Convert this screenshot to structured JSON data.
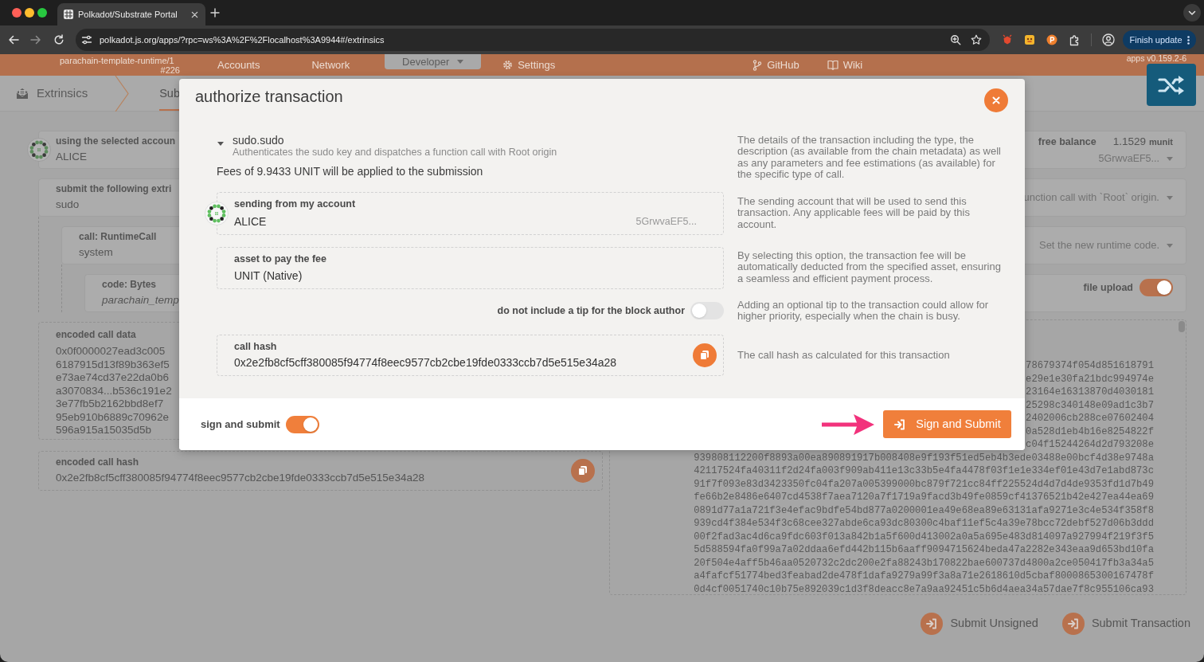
{
  "browser": {
    "tab_title": "Polkadot/Substrate Portal",
    "url": "polkadot.js.org/apps/?rpc=ws%3A%2F%2Flocalhost%3A9944#/extrinsics",
    "update_button": "Finish update"
  },
  "nav": {
    "chain": "parachain-template-runtime/1",
    "block": "#226",
    "menu": [
      {
        "label": "Accounts",
        "selected": false,
        "kind": "menu"
      },
      {
        "label": "Network",
        "selected": false,
        "kind": "menu"
      },
      {
        "label": "Developer",
        "selected": true,
        "kind": "menu"
      },
      {
        "label": "Settings",
        "selected": false,
        "kind": "settings"
      }
    ],
    "links": [
      {
        "label": "GitHub",
        "kind": "repo"
      },
      {
        "label": "Wiki",
        "kind": "docs"
      }
    ],
    "version": "apps v0.159.2-6"
  },
  "subnav": {
    "title": "Extrinsics",
    "tabs": [
      {
        "label": "Sub",
        "selected": true
      }
    ]
  },
  "page": {
    "account": {
      "label": "using the selected accoun",
      "value": "ALICE",
      "balance_label": "free balance",
      "balance": "1.1529",
      "balance_unit": "munit",
      "address": "5GrwvaEF5..."
    },
    "params": [
      {
        "label": "submit the following extri",
        "value": "sudo",
        "summary": "unction call with `Root` origin.",
        "kind": "select",
        "children": [
          {
            "label": "call: RuntimeCall",
            "value": "system",
            "summary": "Set the new runtime code.",
            "kind": "select",
            "children": [
              {
                "label": "code: Bytes",
                "value": "parachain_temp",
                "toggle_label": "file upload",
                "on": true,
                "kind": "file"
              }
            ]
          }
        ]
      }
    ],
    "encoded_call_data": {
      "label": "encoded call data",
      "lines": [
        "0x0f0000027ead3c005",
        "6187915d13f89b363ef5",
        "e73ae74cd37e22da0b6",
        "a3070834...b536c191e2",
        "3e77fb5b2162bbd8ef7",
        "95eb910b6889c70962e",
        "596a915a15035d5b"
      ]
    },
    "hex_dump": {
      "lines": [
        "78679374f054d851618791",
        "e29e1e30fa21bdc994974e",
        "23164e16313870d4030181",
        "25298c340148e09ad1c3b7",
        "2402006cb288ce07602404",
        "0a528d1eb4b16e8254822f",
        "c04f15244264d2d793208e",
        "939808112200f8893a00ea890891917b008408e9f193f51ed5eb4b3ede03488e00bcf4d38e9748a",
        "42117524fa40311f2d24fa003f909ab411e13c33b5e4fa4478f03f1e1e334ef01e43d7e1abd873c",
        "91f7f093e83d3423350fc04fa207a005399000bc879f721cc84ff225524d4d7d4de9353fd1d7b49",
        "fe66b2e8486e6407cd4538f7aea7120a7f1719a9facd3b49fe0859cf41376521b42e427ea44ea69",
        "0891d77a1a721f3e4efac9bdfe54bd877a0200001ea49e68ea89e63131afa9271e3c4e534f358f8",
        "939cd4f384e534f3c68cee327abde6ca93dc80300c4baf11ef5c4a39e78bcc72debf527d06b3ddd",
        "00f2fad3ac4d6ca9fdc603f013a842b1a5f600d413002a0a5a695e483d814097a927994f219f3f5",
        "5d588594fa0f99a7a02ddaa6efd442b115b6aaff9094715624beda47a2282e343eaa9d653bd10fa",
        "20f504e4aff5b46aa0520732c2dc200e2fa88243b170822bae600737d4800a2ce050417fb3a34a5",
        "a4fafcf51774bed3feabad2de478f1dafa9279a99f3a8a71e2618610d5cbaf8000865300167478f",
        "0d4cf0051740c10b75e892039c1d3f8deacc8e7a9aa92451c5b6d4aea34a57dae7f8c955106ca93"
      ]
    },
    "encoded_call_hash": {
      "label": "encoded call hash",
      "value": "0x2e2fb8cf5cff380085f94774f8eec9577cb2cbe19fde0333ccb7d5e515e34a28"
    },
    "actions": [
      {
        "label": "Submit Unsigned"
      },
      {
        "label": "Submit Transaction"
      }
    ]
  },
  "modal": {
    "title": "authorize transaction",
    "sections": [
      {
        "kind": "call",
        "name": "sudo.sudo",
        "description": "Authenticates the sudo key and dispatches a function call with Root origin",
        "expanded": true,
        "fees": "Fees of 9.9433 UNIT will be applied to the submission",
        "help": "The details of the transaction including the type, the description (as available from the chain metadata) as well as any parameters and fee estimations (as available) for the specific type of call."
      },
      {
        "kind": "account",
        "label": "sending from my account",
        "value": "ALICE",
        "address": "5GrwvaEF5...",
        "help": "The sending account that will be used to send this transaction. Any applicable fees will be paid by this account."
      },
      {
        "kind": "field",
        "label": "asset to pay the fee",
        "value": "UNIT (Native)",
        "help": "By selecting this option, the transaction fee will be automatically deducted from the specified asset, ensuring a seamless and efficient payment process."
      },
      {
        "kind": "toggle",
        "label": "do not include a tip for the block author",
        "on": false,
        "help": "Adding an optional tip to the transaction could allow for higher priority, especially when the chain is busy."
      },
      {
        "kind": "hash",
        "label": "call hash",
        "value": "0x2e2fb8cf5cff380085f94774f8eec9577cb2cbe19fde0333ccb7d5e515e34a28",
        "help": "The call hash as calculated for this transaction"
      }
    ],
    "footer": {
      "toggle_label": "sign and submit",
      "on": true,
      "button": "Sign and Submit"
    }
  }
}
